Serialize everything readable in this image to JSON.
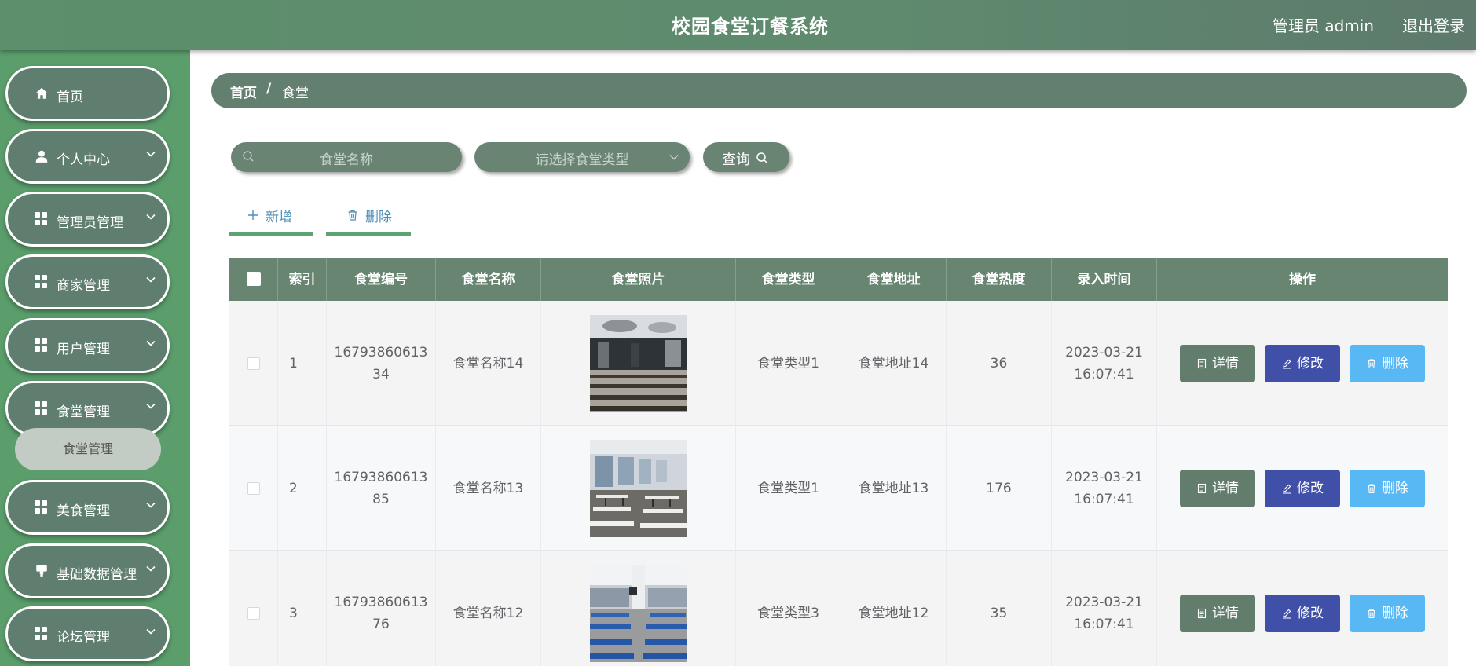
{
  "header": {
    "title": "校园食堂订餐系统",
    "user_label": "管理员 admin",
    "logout_label": "退出登录"
  },
  "sidebar": {
    "items": [
      {
        "label": "首页",
        "icon": "home-icon",
        "has_arrow": false
      },
      {
        "label": "个人中心",
        "icon": "user-icon",
        "has_arrow": true
      },
      {
        "label": "管理员管理",
        "icon": "grid-icon",
        "has_arrow": true
      },
      {
        "label": "商家管理",
        "icon": "grid-icon",
        "has_arrow": true
      },
      {
        "label": "用户管理",
        "icon": "grid-icon",
        "has_arrow": true
      },
      {
        "label": "食堂管理",
        "icon": "grid-icon",
        "has_arrow": true
      },
      {
        "label": "美食管理",
        "icon": "grid-icon",
        "has_arrow": true
      },
      {
        "label": "基础数据管理",
        "icon": "stamp-icon",
        "has_arrow": true
      },
      {
        "label": "论坛管理",
        "icon": "grid-icon",
        "has_arrow": true
      }
    ],
    "submenu": {
      "label": "食堂管理"
    }
  },
  "breadcrumb": {
    "home": "首页",
    "separator": "/",
    "current": "食堂"
  },
  "search": {
    "name_placeholder": "食堂名称",
    "type_placeholder": "请选择食堂类型",
    "query_label": "查询"
  },
  "toolbar": {
    "add_label": "新增",
    "delete_label": "删除"
  },
  "table": {
    "columns": [
      "索引",
      "食堂编号",
      "食堂名称",
      "食堂照片",
      "食堂类型",
      "食堂地址",
      "食堂热度",
      "录入时间",
      "操作"
    ],
    "rows": [
      {
        "index": "1",
        "code_line1": "16793860613",
        "code_line2": "34",
        "name": "食堂名称14",
        "type": "食堂类型1",
        "address": "食堂地址14",
        "heat": "36",
        "date": "2023-03-21",
        "time": "16:07:41"
      },
      {
        "index": "2",
        "code_line1": "16793860613",
        "code_line2": "85",
        "name": "食堂名称13",
        "type": "食堂类型1",
        "address": "食堂地址13",
        "heat": "176",
        "date": "2023-03-21",
        "time": "16:07:41"
      },
      {
        "index": "3",
        "code_line1": "16793860613",
        "code_line2": "76",
        "name": "食堂名称12",
        "type": "食堂类型3",
        "address": "食堂地址12",
        "heat": "35",
        "date": "2023-03-21",
        "time": "16:07:41"
      }
    ],
    "actions": {
      "detail": "详情",
      "edit": "修改",
      "delete": "删除"
    }
  },
  "colors": {
    "header_bg": "#5f8a6e",
    "sidebar_bg": "#5b9e6c",
    "menu_item_bg": "#5f7e6f",
    "table_header_bg": "#678571",
    "detail_btn": "#627d6c",
    "edit_btn": "#4050a8",
    "delete_btn": "#58b8f4"
  }
}
